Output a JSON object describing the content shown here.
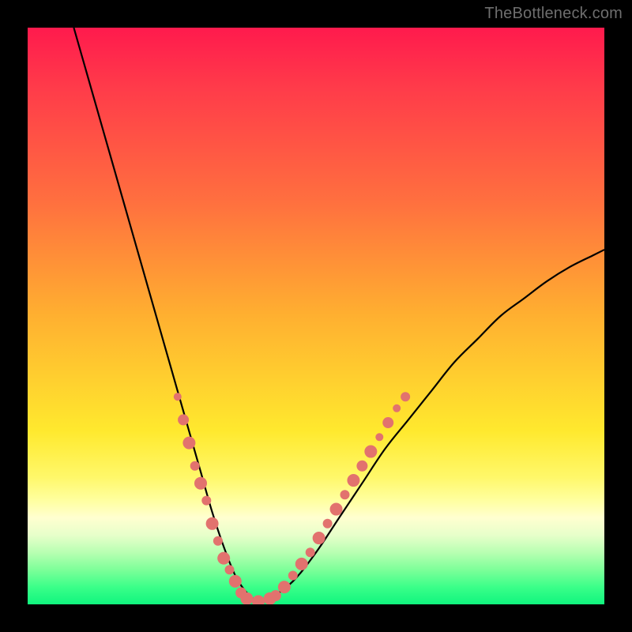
{
  "watermark": "TheBottleneck.com",
  "chart_data": {
    "type": "line",
    "title": "",
    "xlabel": "",
    "ylabel": "",
    "xlim": [
      0,
      100
    ],
    "ylim": [
      0,
      100
    ],
    "grid": false,
    "legend": false,
    "series": [
      {
        "name": "bottleneck-curve",
        "color": "#000000",
        "x": [
          8,
          10,
          12,
          14,
          16,
          18,
          20,
          22,
          24,
          26,
          28,
          30,
          32,
          34,
          36,
          38,
          40,
          42,
          46,
          50,
          54,
          58,
          62,
          66,
          70,
          74,
          78,
          82,
          86,
          90,
          94,
          98,
          100
        ],
        "y": [
          100,
          93,
          86,
          79,
          72,
          65,
          58,
          51,
          44,
          37,
          30,
          23,
          16,
          10,
          5,
          2,
          0.5,
          1,
          4,
          9,
          15,
          21,
          27,
          32,
          37,
          42,
          46,
          50,
          53,
          56,
          58.5,
          60.5,
          61.5
        ]
      }
    ],
    "overlay_points": {
      "name": "highlighted-components",
      "color": "#e2726e",
      "radius_range": [
        4,
        9
      ],
      "points": [
        {
          "x": 26,
          "y": 36,
          "r": 5
        },
        {
          "x": 27,
          "y": 32,
          "r": 7
        },
        {
          "x": 28,
          "y": 28,
          "r": 8
        },
        {
          "x": 29,
          "y": 24,
          "r": 6
        },
        {
          "x": 30,
          "y": 21,
          "r": 8
        },
        {
          "x": 31,
          "y": 18,
          "r": 6
        },
        {
          "x": 32,
          "y": 14,
          "r": 8
        },
        {
          "x": 33,
          "y": 11,
          "r": 6
        },
        {
          "x": 34,
          "y": 8,
          "r": 8
        },
        {
          "x": 35,
          "y": 6,
          "r": 6
        },
        {
          "x": 36,
          "y": 4,
          "r": 8
        },
        {
          "x": 37,
          "y": 2,
          "r": 7
        },
        {
          "x": 38,
          "y": 1,
          "r": 8
        },
        {
          "x": 40,
          "y": 0.5,
          "r": 8
        },
        {
          "x": 42,
          "y": 1,
          "r": 8
        },
        {
          "x": 43,
          "y": 1.5,
          "r": 7
        },
        {
          "x": 44.5,
          "y": 3,
          "r": 8
        },
        {
          "x": 46,
          "y": 5,
          "r": 6
        },
        {
          "x": 47.5,
          "y": 7,
          "r": 8
        },
        {
          "x": 49,
          "y": 9,
          "r": 6
        },
        {
          "x": 50.5,
          "y": 11.5,
          "r": 8
        },
        {
          "x": 52,
          "y": 14,
          "r": 6
        },
        {
          "x": 53.5,
          "y": 16.5,
          "r": 8
        },
        {
          "x": 55,
          "y": 19,
          "r": 6
        },
        {
          "x": 56.5,
          "y": 21.5,
          "r": 8
        },
        {
          "x": 58,
          "y": 24,
          "r": 7
        },
        {
          "x": 59.5,
          "y": 26.5,
          "r": 8
        },
        {
          "x": 61,
          "y": 29,
          "r": 5
        },
        {
          "x": 62.5,
          "y": 31.5,
          "r": 7
        },
        {
          "x": 64,
          "y": 34,
          "r": 5
        },
        {
          "x": 65.5,
          "y": 36,
          "r": 6
        }
      ]
    },
    "background_gradient": {
      "stops": [
        {
          "pos": 0,
          "color": "#ff1a4d"
        },
        {
          "pos": 50,
          "color": "#ffb030"
        },
        {
          "pos": 78,
          "color": "#fff86a"
        },
        {
          "pos": 100,
          "color": "#10f57e"
        }
      ]
    }
  }
}
